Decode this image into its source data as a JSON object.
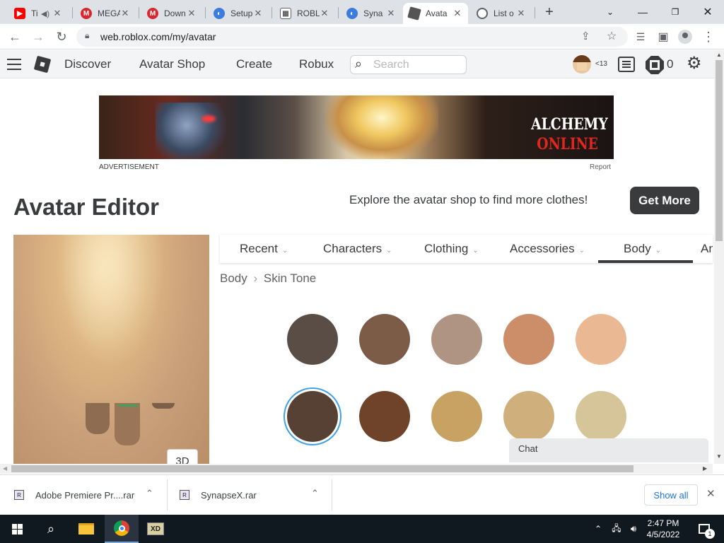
{
  "browser": {
    "tabs": [
      {
        "title": "Ti",
        "favicon": "youtube-icon",
        "color": "#ff0000",
        "audio": true
      },
      {
        "title": "MEGA",
        "favicon": "mega-icon",
        "color": "#d9272e"
      },
      {
        "title": "Down",
        "favicon": "mega-icon",
        "color": "#d9272e"
      },
      {
        "title": "Setup",
        "favicon": "synapse-icon",
        "color": "#3b7ddd"
      },
      {
        "title": "ROBL",
        "favicon": "roblox-icon",
        "color": "#606060"
      },
      {
        "title": "Syna",
        "favicon": "synapse-icon",
        "color": "#3b7ddd"
      },
      {
        "title": "Avata",
        "favicon": "roblox-icon",
        "color": "#555555"
      },
      {
        "title": "List o",
        "favicon": "globe-icon",
        "color": "#5f6368"
      }
    ],
    "url": "web.roblox.com/my/avatar"
  },
  "nav": {
    "links": [
      "Discover",
      "Avatar Shop",
      "Create",
      "Robux"
    ],
    "search_placeholder": "Search",
    "age_badge": "<13",
    "robux_count": "0"
  },
  "ad": {
    "logo_line1": "ALCHEMY",
    "logo_line2": "ONLINE",
    "label": "ADVERTISEMENT",
    "report": "Report"
  },
  "page": {
    "title": "Avatar Editor",
    "explore_text": "Explore the avatar shop to find more clothes!",
    "get_more": "Get More",
    "view_3d": "3D"
  },
  "categories": [
    "Recent",
    "Characters",
    "Clothing",
    "Accessories",
    "Body",
    "Animations"
  ],
  "active_category": "Body",
  "breadcrumb": {
    "parent": "Body",
    "sep": "›",
    "current": "Skin Tone"
  },
  "skin_tones": [
    {
      "color": "#594d45",
      "selected": false
    },
    {
      "color": "#7c5c46",
      "selected": false
    },
    {
      "color": "#af9483",
      "selected": false
    },
    {
      "color": "#cc8e69",
      "selected": false
    },
    {
      "color": "#eab892",
      "selected": false
    },
    {
      "color": "#574134",
      "selected": true
    },
    {
      "color": "#6f432a",
      "selected": false
    },
    {
      "color": "#c7a263",
      "selected": false
    },
    {
      "color": "#cfb07d",
      "selected": false
    },
    {
      "color": "#d7c59a",
      "selected": false
    }
  ],
  "chat": {
    "label": "Chat"
  },
  "downloads": {
    "items": [
      {
        "name": "Adobe Premiere Pr....rar"
      },
      {
        "name": "SynapseX.rar"
      }
    ],
    "show_all": "Show all"
  },
  "taskbar": {
    "time": "2:47 PM",
    "date": "4/5/2022",
    "notifications": "1"
  }
}
